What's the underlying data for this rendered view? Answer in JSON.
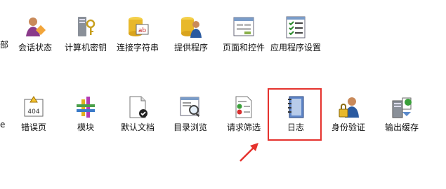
{
  "row1": {
    "cut_label": "部",
    "items": [
      {
        "label": "会话状态",
        "icon": "session-state-icon"
      },
      {
        "label": "计算机密钥",
        "icon": "machine-key-icon"
      },
      {
        "label": "连接字符串",
        "icon": "connection-string-icon"
      },
      {
        "label": "提供程序",
        "icon": "providers-icon"
      },
      {
        "label": "页面和控件",
        "icon": "pages-controls-icon"
      },
      {
        "label": "应用程序设置",
        "icon": "app-settings-icon"
      }
    ]
  },
  "row2": {
    "cut_label": "e",
    "items": [
      {
        "label": "错误页",
        "icon": "error-pages-icon",
        "badge": "404"
      },
      {
        "label": "模块",
        "icon": "modules-icon"
      },
      {
        "label": "默认文档",
        "icon": "default-document-icon"
      },
      {
        "label": "目录浏览",
        "icon": "directory-browsing-icon"
      },
      {
        "label": "请求筛选",
        "icon": "request-filtering-icon"
      },
      {
        "label": "日志",
        "icon": "logging-icon"
      },
      {
        "label": "身份验证",
        "icon": "authentication-icon"
      },
      {
        "label": "输出缓存",
        "icon": "output-caching-icon"
      }
    ]
  },
  "annotation": {
    "color": "#e5322d",
    "marker": "arrow"
  }
}
